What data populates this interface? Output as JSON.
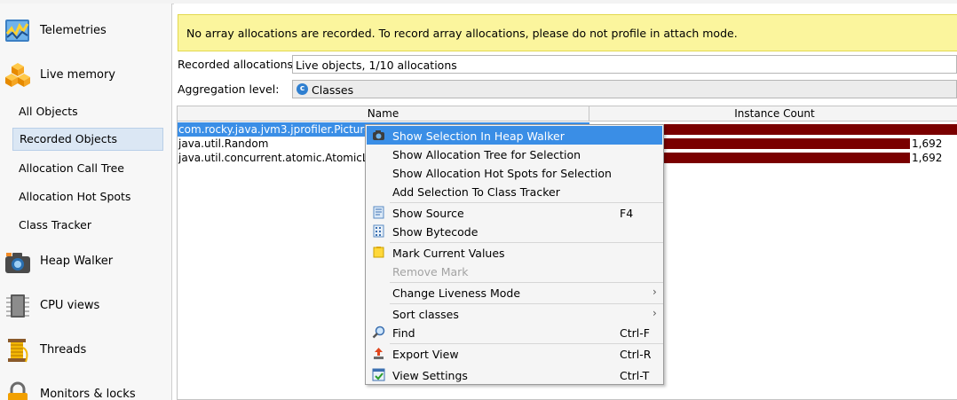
{
  "sidebar": {
    "sections": [
      {
        "label": "Telemetries",
        "icon": "telemetries-icon"
      },
      {
        "label": "Live memory",
        "icon": "live-memory-icon"
      },
      {
        "label": "Heap Walker",
        "icon": "camera-icon"
      },
      {
        "label": "CPU views",
        "icon": "cpu-chip-icon"
      },
      {
        "label": "Threads",
        "icon": "threads-icon"
      },
      {
        "label": "Monitors & locks",
        "icon": "lock-icon"
      }
    ],
    "live_memory_items": [
      {
        "label": "All Objects"
      },
      {
        "label": "Recorded Objects",
        "selected": true
      },
      {
        "label": "Allocation Call Tree"
      },
      {
        "label": "Allocation Hot Spots"
      },
      {
        "label": "Class Tracker"
      }
    ]
  },
  "banner": {
    "text": "No array allocations are recorded. To record array allocations, please do not profile in attach mode.",
    "color": "#fbf59d"
  },
  "recorded": {
    "label": "Recorded allocations:",
    "value": "Live objects, 1/10 allocations"
  },
  "aggregation": {
    "label": "Aggregation level:",
    "value": "Classes",
    "icon": "class-c-icon"
  },
  "table": {
    "headers": {
      "name": "Name",
      "count": "Instance Count"
    },
    "rows": [
      {
        "name": "com.rocky.java.jvm3.jprofiler.Picture",
        "count": "",
        "fraction": 1.0,
        "selected": true
      },
      {
        "name": "java.util.Random",
        "count": "1,692",
        "fraction": 0.865
      },
      {
        "name": "java.util.concurrent.atomic.AtomicLong",
        "count": "1,692",
        "fraction": 0.865
      }
    ],
    "bar_color": "#7a0000",
    "selection_color": "#3a8ee6"
  },
  "context_menu": {
    "items": [
      {
        "label": "Show Selection In Heap Walker",
        "icon": "camera-icon",
        "highlighted": true
      },
      {
        "label": "Show Allocation Tree for Selection"
      },
      {
        "label": "Show Allocation Hot Spots for Selection"
      },
      {
        "label": "Add Selection To Class Tracker"
      },
      {
        "label": "Show Source",
        "icon": "source-file-icon",
        "shortcut": "F4"
      },
      {
        "label": "Show Bytecode",
        "icon": "bytecode-icon"
      },
      {
        "label": "Mark Current Values",
        "icon": "note-icon"
      },
      {
        "label": "Remove Mark",
        "disabled": true
      },
      {
        "label": "Change Liveness Mode",
        "submenu": true
      },
      {
        "label": "Sort classes",
        "submenu": true
      },
      {
        "label": "Find",
        "icon": "magnifier-icon",
        "shortcut": "Ctrl-F"
      },
      {
        "label": "Export View",
        "icon": "export-icon",
        "shortcut": "Ctrl-R"
      },
      {
        "label": "View Settings",
        "icon": "settings-window-icon",
        "shortcut": "Ctrl-T"
      }
    ],
    "highlight_color": "#3a8ee6"
  }
}
